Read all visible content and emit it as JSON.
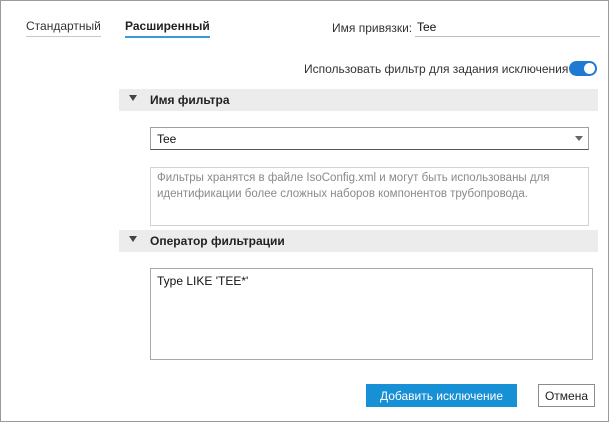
{
  "tabs": [
    {
      "label": "Стандартный",
      "active": false
    },
    {
      "label": "Расширенный",
      "active": true
    }
  ],
  "binding": {
    "label": "Имя привязки:",
    "value": "Tee"
  },
  "use_filter": {
    "label": "Использовать фильтр для задания исключения",
    "enabled": true,
    "accent": "#1e7ad2"
  },
  "filter_name_section": {
    "title": "Имя фильтра",
    "selected": "Tee",
    "description": "Фильтры хранятся в файле IsoConfig.xml и могут быть использованы для идентификации более сложных наборов компонентов трубопровода."
  },
  "filter_operator_section": {
    "title": "Оператор фильтрации",
    "expression": "Type LIKE 'TEE*'"
  },
  "buttons": {
    "add_exception": "Добавить исключение",
    "cancel": "Отмена",
    "primary_color": "#1890d6"
  }
}
